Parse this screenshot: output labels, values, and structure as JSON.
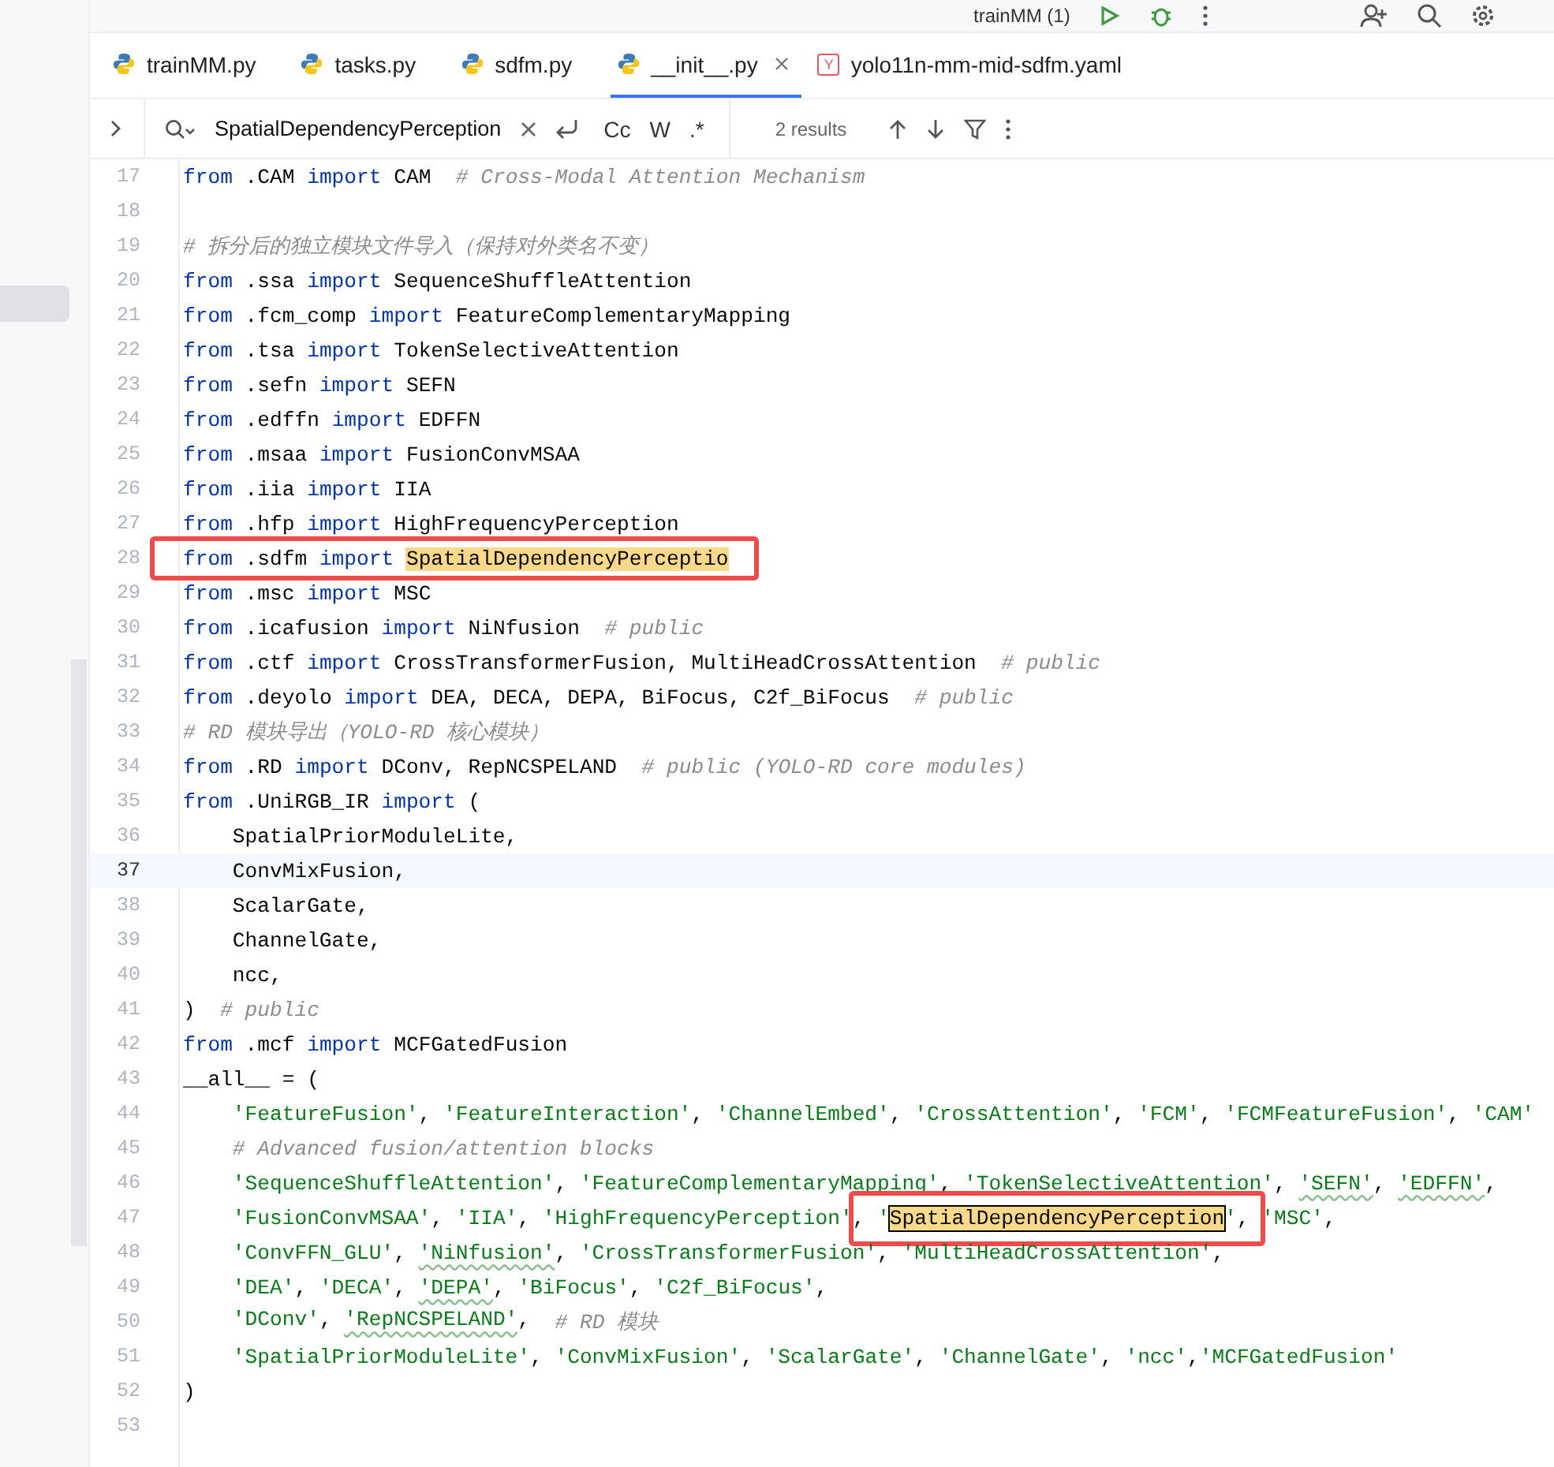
{
  "toolbar": {
    "run_config": "trainMM (1)"
  },
  "tabs": [
    {
      "label": "trainMM.py",
      "kind": "python",
      "selected": false
    },
    {
      "label": "tasks.py",
      "kind": "python",
      "selected": false
    },
    {
      "label": "sdfm.py",
      "kind": "python",
      "selected": false
    },
    {
      "label": "__init__.py",
      "kind": "python",
      "selected": true
    },
    {
      "label": "yolo11n-mm-mid-sdfm.yaml",
      "kind": "yaml",
      "badge": "Y",
      "selected": false
    }
  ],
  "find_bar": {
    "value": "SpatialDependencyPerception",
    "options": [
      "Cc",
      "W",
      ".*"
    ],
    "results": "2 results"
  },
  "code": {
    "lines": [
      {
        "number": "17",
        "current": false,
        "tokens": [
          {
            "kind": "kw",
            "text": "from"
          },
          {
            "kind": "plain",
            "text": " .CAM "
          },
          {
            "kind": "kw",
            "text": "import"
          },
          {
            "kind": "plain",
            "text": " CAM  "
          },
          {
            "kind": "comment",
            "text": "# Cross-Modal Attention Mechanism"
          }
        ]
      },
      {
        "number": "18",
        "current": false
      },
      {
        "number": "19",
        "current": false,
        "tokens": [
          {
            "kind": "comment",
            "text": "# 拆分后的独立模块文件导入（保持对外类名不变）"
          }
        ]
      },
      {
        "number": "20",
        "current": false,
        "tokens": [
          {
            "kind": "kw",
            "text": "from"
          },
          {
            "kind": "plain",
            "text": " .ssa "
          },
          {
            "kind": "kw",
            "text": "import"
          },
          {
            "kind": "plain",
            "text": " SequenceShuffleAttention"
          }
        ]
      },
      {
        "number": "21",
        "current": false,
        "tokens": [
          {
            "kind": "kw",
            "text": "from"
          },
          {
            "kind": "plain",
            "text": " .fcm_comp "
          },
          {
            "kind": "kw",
            "text": "import"
          },
          {
            "kind": "plain",
            "text": " FeatureComplementaryMapping"
          }
        ]
      },
      {
        "number": "22",
        "current": false,
        "tokens": [
          {
            "kind": "kw",
            "text": "from"
          },
          {
            "kind": "plain",
            "text": " .tsa "
          },
          {
            "kind": "kw",
            "text": "import"
          },
          {
            "kind": "plain",
            "text": " TokenSelectiveAttention"
          }
        ]
      },
      {
        "number": "23",
        "current": false,
        "tokens": [
          {
            "kind": "kw",
            "text": "from"
          },
          {
            "kind": "plain",
            "text": " .sefn "
          },
          {
            "kind": "kw",
            "text": "import"
          },
          {
            "kind": "plain",
            "text": " SEFN"
          }
        ]
      },
      {
        "number": "24",
        "current": false,
        "tokens": [
          {
            "kind": "kw",
            "text": "from"
          },
          {
            "kind": "plain",
            "text": " .edffn "
          },
          {
            "kind": "kw",
            "text": "import"
          },
          {
            "kind": "plain",
            "text": " EDFFN"
          }
        ]
      },
      {
        "number": "25",
        "current": false,
        "tokens": [
          {
            "kind": "kw",
            "text": "from"
          },
          {
            "kind": "plain",
            "text": " .msaa "
          },
          {
            "kind": "kw",
            "text": "import"
          },
          {
            "kind": "plain",
            "text": " FusionConvMSAA"
          }
        ]
      },
      {
        "number": "26",
        "current": false,
        "tokens": [
          {
            "kind": "kw",
            "text": "from"
          },
          {
            "kind": "plain",
            "text": " .iia "
          },
          {
            "kind": "kw",
            "text": "import"
          },
          {
            "kind": "plain",
            "text": " IIA"
          }
        ]
      },
      {
        "number": "27",
        "current": false,
        "tokens": [
          {
            "kind": "kw",
            "text": "from"
          },
          {
            "kind": "plain",
            "text": " .hfp "
          },
          {
            "kind": "kw",
            "text": "import"
          },
          {
            "kind": "plain",
            "text": " HighFrequencyPerception"
          }
        ]
      },
      {
        "number": "28",
        "current": false,
        "boxed": true,
        "tokens": [
          {
            "kind": "kw",
            "text": "from"
          },
          {
            "kind": "plain",
            "text": " .sdfm "
          },
          {
            "kind": "kw",
            "text": "import "
          },
          {
            "kind": "match",
            "text": "SpatialDependencyPerceptio"
          }
        ]
      },
      {
        "number": "29",
        "current": false,
        "tokens": [
          {
            "kind": "kw",
            "text": "from"
          },
          {
            "kind": "plain",
            "text": " .msc "
          },
          {
            "kind": "kw",
            "text": "import"
          },
          {
            "kind": "plain",
            "text": " MSC"
          }
        ]
      },
      {
        "number": "30",
        "current": false,
        "tokens": [
          {
            "kind": "kw",
            "text": "from"
          },
          {
            "kind": "plain",
            "text": " .icafusion "
          },
          {
            "kind": "kw",
            "text": "import"
          },
          {
            "kind": "plain",
            "text": " NiNfusion  "
          },
          {
            "kind": "comment",
            "text": "# public"
          }
        ]
      },
      {
        "number": "31",
        "current": false,
        "tokens": [
          {
            "kind": "kw",
            "text": "from"
          },
          {
            "kind": "plain",
            "text": " .ctf "
          },
          {
            "kind": "kw",
            "text": "import"
          },
          {
            "kind": "plain",
            "text": " CrossTransformerFusion, MultiHeadCrossAttention  "
          },
          {
            "kind": "comment",
            "text": "# public"
          }
        ]
      },
      {
        "number": "32",
        "current": false,
        "tokens": [
          {
            "kind": "kw",
            "text": "from"
          },
          {
            "kind": "plain",
            "text": " .deyolo "
          },
          {
            "kind": "kw",
            "text": "import"
          },
          {
            "kind": "plain",
            "text": " DEA, DECA, DEPA, BiFocus, C2f_BiFocus  "
          },
          {
            "kind": "comment",
            "text": "# public"
          }
        ]
      },
      {
        "number": "33",
        "current": false,
        "tokens": [
          {
            "kind": "comment",
            "text": "# RD 模块导出（YOLO-RD 核心模块）"
          }
        ]
      },
      {
        "number": "34",
        "current": false,
        "tokens": [
          {
            "kind": "kw",
            "text": "from"
          },
          {
            "kind": "plain",
            "text": " .RD "
          },
          {
            "kind": "kw",
            "text": "import"
          },
          {
            "kind": "plain",
            "text": " DConv, RepNCSPELAND  "
          },
          {
            "kind": "comment",
            "text": "# public (YOLO-RD core modules)"
          }
        ]
      },
      {
        "number": "35",
        "current": false,
        "tokens": [
          {
            "kind": "kw",
            "text": "from"
          },
          {
            "kind": "plain",
            "text": " .UniRGB_IR "
          },
          {
            "kind": "kw",
            "text": "import"
          },
          {
            "kind": "plain",
            "text": " ("
          }
        ]
      },
      {
        "number": "36",
        "current": false,
        "indented": true,
        "tokens": [
          {
            "kind": "plain",
            "text": "SpatialPriorModuleLite,"
          }
        ]
      },
      {
        "number": "37",
        "current": true,
        "indented": true,
        "tokens": [
          {
            "kind": "plain",
            "text": "ConvMixFusion,"
          }
        ]
      },
      {
        "number": "38",
        "current": false,
        "indented": true,
        "tokens": [
          {
            "kind": "plain",
            "text": "ScalarGate,"
          }
        ]
      },
      {
        "number": "39",
        "current": false,
        "indented": true,
        "tokens": [
          {
            "kind": "plain",
            "text": "ChannelGate,"
          }
        ]
      },
      {
        "number": "40",
        "current": false,
        "indented": true,
        "tokens": [
          {
            "kind": "plain",
            "text": "ncc,"
          }
        ]
      },
      {
        "number": "41",
        "current": false,
        "tokens": [
          {
            "kind": "plain",
            "text": ")  "
          },
          {
            "kind": "comment",
            "text": "# public"
          }
        ]
      },
      {
        "number": "42",
        "current": false,
        "tokens": [
          {
            "kind": "kw",
            "text": "from"
          },
          {
            "kind": "plain",
            "text": " .mcf "
          },
          {
            "kind": "kw",
            "text": "import"
          },
          {
            "kind": "plain",
            "text": " MCFGatedFusion"
          }
        ]
      },
      {
        "number": "43",
        "current": false,
        "tokens": [
          {
            "kind": "plain",
            "text": "__all__ = ("
          }
        ]
      },
      {
        "number": "44",
        "current": false,
        "indented": true,
        "tokens": [
          {
            "kind": "str",
            "text": "'FeatureFusion'"
          },
          {
            "kind": "plain",
            "text": ", "
          },
          {
            "kind": "str",
            "text": "'FeatureInteraction'"
          },
          {
            "kind": "plain",
            "text": ", "
          },
          {
            "kind": "str",
            "text": "'ChannelEmbed'"
          },
          {
            "kind": "plain",
            "text": ", "
          },
          {
            "kind": "str",
            "text": "'CrossAttention'"
          },
          {
            "kind": "plain",
            "text": ", "
          },
          {
            "kind": "str",
            "text": "'FCM'"
          },
          {
            "kind": "plain",
            "text": ", "
          },
          {
            "kind": "str",
            "text": "'FCMFeatureFusion'"
          },
          {
            "kind": "plain",
            "text": ", "
          },
          {
            "kind": "str",
            "text": "'CAM'"
          }
        ]
      },
      {
        "number": "45",
        "current": false,
        "indented": true,
        "tokens": [
          {
            "kind": "comment",
            "text": "# Advanced fusion/attention blocks"
          }
        ]
      },
      {
        "number": "46",
        "current": false,
        "indented": true,
        "tokens": [
          {
            "kind": "str",
            "text": "'SequenceShuffleAttention'"
          },
          {
            "kind": "plain",
            "text": ", "
          },
          {
            "kind": "str",
            "text": "'FeatureComplementaryMapping'"
          },
          {
            "kind": "plain",
            "text": ", "
          },
          {
            "kind": "str",
            "text": "'TokenSelectiveAttention'"
          },
          {
            "kind": "plain",
            "text": ", "
          },
          {
            "kind": "str_typo",
            "text": "'SEFN'"
          },
          {
            "kind": "plain",
            "text": ", "
          },
          {
            "kind": "str_typo",
            "text": "'EDFFN'"
          },
          {
            "kind": "plain",
            "text": ","
          }
        ]
      },
      {
        "number": "47",
        "current": false,
        "indented": true,
        "boxed": true,
        "tokens": [
          {
            "kind": "str",
            "text": "'FusionConvMSAA'"
          },
          {
            "kind": "plain",
            "text": ", "
          },
          {
            "kind": "str",
            "text": "'IIA'"
          },
          {
            "kind": "plain",
            "text": ", "
          },
          {
            "kind": "str",
            "text": "'HighFrequencyPerception'"
          },
          {
            "kind": "plain",
            "text": ", "
          },
          {
            "kind": "str",
            "text": "'"
          },
          {
            "kind": "match_current",
            "text": "SpatialDependencyPerception"
          },
          {
            "kind": "str",
            "text": "'"
          },
          {
            "kind": "plain",
            "text": ", "
          },
          {
            "kind": "str",
            "text": "'MSC'"
          },
          {
            "kind": "plain",
            "text": ","
          }
        ]
      },
      {
        "number": "48",
        "current": false,
        "indented": true,
        "tokens": [
          {
            "kind": "str",
            "text": "'ConvFFN_GLU'"
          },
          {
            "kind": "plain",
            "text": ", "
          },
          {
            "kind": "str_typo",
            "text": "'NiNfusion'"
          },
          {
            "kind": "plain",
            "text": ", "
          },
          {
            "kind": "str",
            "text": "'CrossTransformerFusion'"
          },
          {
            "kind": "plain",
            "text": ", "
          },
          {
            "kind": "str",
            "text": "'MultiHeadCrossAttention'"
          },
          {
            "kind": "plain",
            "text": ","
          }
        ]
      },
      {
        "number": "49",
        "current": false,
        "indented": true,
        "tokens": [
          {
            "kind": "str",
            "text": "'DEA'"
          },
          {
            "kind": "plain",
            "text": ", "
          },
          {
            "kind": "str",
            "text": "'DECA'"
          },
          {
            "kind": "plain",
            "text": ", "
          },
          {
            "kind": "str_typo",
            "text": "'DEPA'"
          },
          {
            "kind": "plain",
            "text": ", "
          },
          {
            "kind": "str",
            "text": "'BiFocus'"
          },
          {
            "kind": "plain",
            "text": ", "
          },
          {
            "kind": "str",
            "text": "'C2f_BiFocus'"
          },
          {
            "kind": "plain",
            "text": ","
          }
        ]
      },
      {
        "number": "50",
        "current": false,
        "indented": true,
        "tokens": [
          {
            "kind": "str",
            "text": "'DConv'"
          },
          {
            "kind": "plain",
            "text": ", "
          },
          {
            "kind": "str_typo",
            "text": "'RepNCSPELAND'"
          },
          {
            "kind": "plain",
            "text": ",  "
          },
          {
            "kind": "comment",
            "text": "# RD 模块"
          }
        ]
      },
      {
        "number": "51",
        "current": false,
        "indented": true,
        "tokens": [
          {
            "kind": "str",
            "text": "'SpatialPriorModuleLite'"
          },
          {
            "kind": "plain",
            "text": ", "
          },
          {
            "kind": "str",
            "text": "'ConvMixFusion'"
          },
          {
            "kind": "plain",
            "text": ", "
          },
          {
            "kind": "str",
            "text": "'ScalarGate'"
          },
          {
            "kind": "plain",
            "text": ", "
          },
          {
            "kind": "str",
            "text": "'ChannelGate'"
          },
          {
            "kind": "plain",
            "text": ", "
          },
          {
            "kind": "str",
            "text": "'ncc'"
          },
          {
            "kind": "plain",
            "text": ","
          },
          {
            "kind": "str",
            "text": "'MCFGatedFusion'"
          }
        ]
      },
      {
        "number": "52",
        "current": false,
        "tokens": [
          {
            "kind": "plain",
            "text": ")"
          }
        ]
      },
      {
        "number": "53",
        "current": false
      }
    ]
  }
}
